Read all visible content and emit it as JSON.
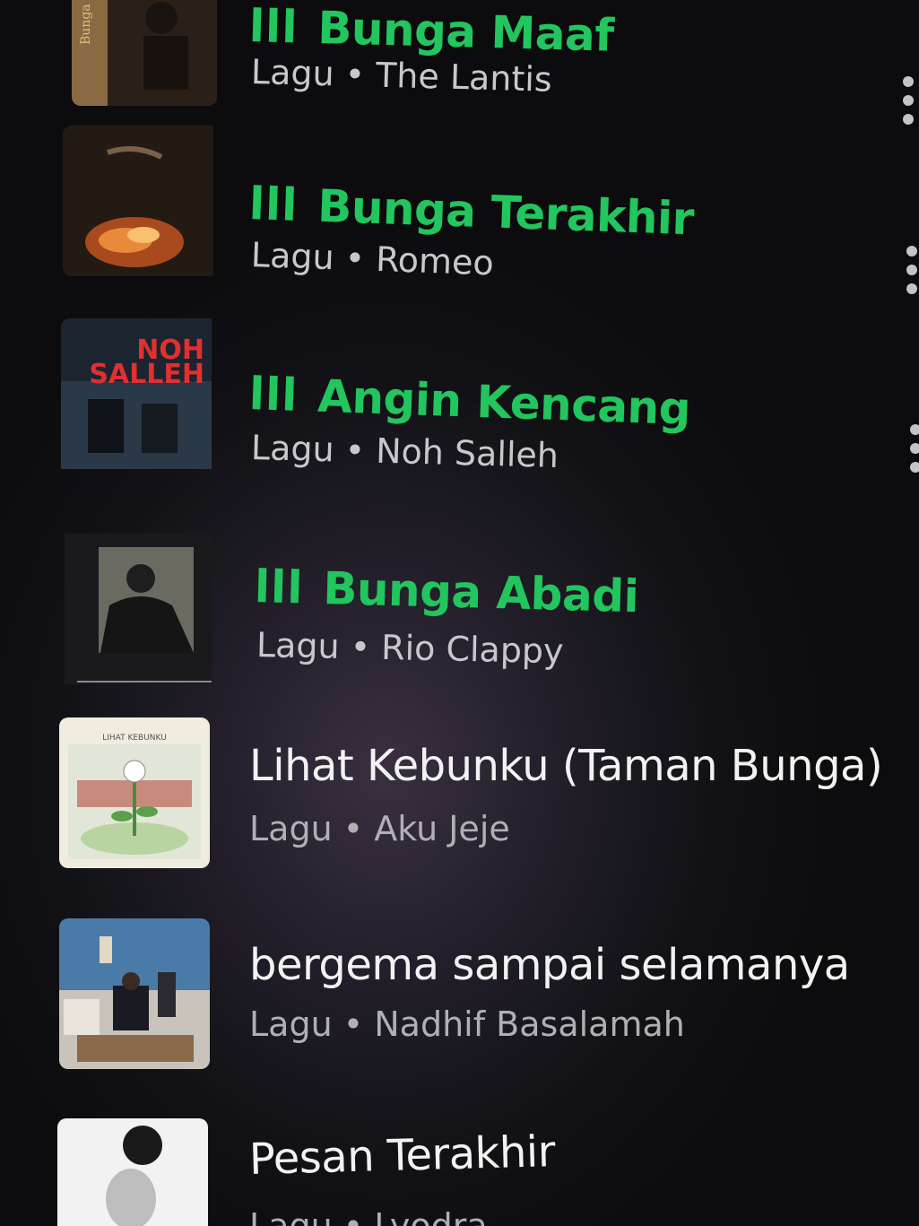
{
  "list": {
    "items": [
      {
        "title": "Bunga Maaf",
        "subtitle": "Lagu • The Lantis",
        "playing": true,
        "art_text": "Bunga Maaf",
        "has_menu": true
      },
      {
        "title": "Bunga Terakhir",
        "subtitle": "Lagu • Romeo",
        "playing": true,
        "art_text": "",
        "has_menu": true
      },
      {
        "title": "Angin Kencang",
        "subtitle": "Lagu • Noh Salleh",
        "playing": true,
        "art_text": "NOH SALLEH",
        "has_menu": true
      },
      {
        "title": "Bunga Abadi",
        "subtitle": "Lagu • Rio Clappy",
        "playing": true,
        "art_text": "",
        "has_menu": false
      },
      {
        "title": "Lihat Kebunku (Taman Bunga)",
        "subtitle": "Lagu • Aku Jeje",
        "playing": false,
        "art_text": "LIHAT KEBUNKU",
        "has_menu": false
      },
      {
        "title": "bergema sampai selamanya",
        "subtitle": "Lagu • Nadhif Basalamah",
        "playing": false,
        "art_text": "",
        "has_menu": false
      },
      {
        "title": "Pesan Terakhir",
        "subtitle": "Lagu • Lyodra",
        "playing": false,
        "art_text": "",
        "has_menu": false
      }
    ],
    "playing_indicator": "lll",
    "colors": {
      "playing_title": "#22c55e",
      "normal_title": "#f2f2f2",
      "subtitle": "#c8c8cc",
      "background": "#121216"
    }
  }
}
